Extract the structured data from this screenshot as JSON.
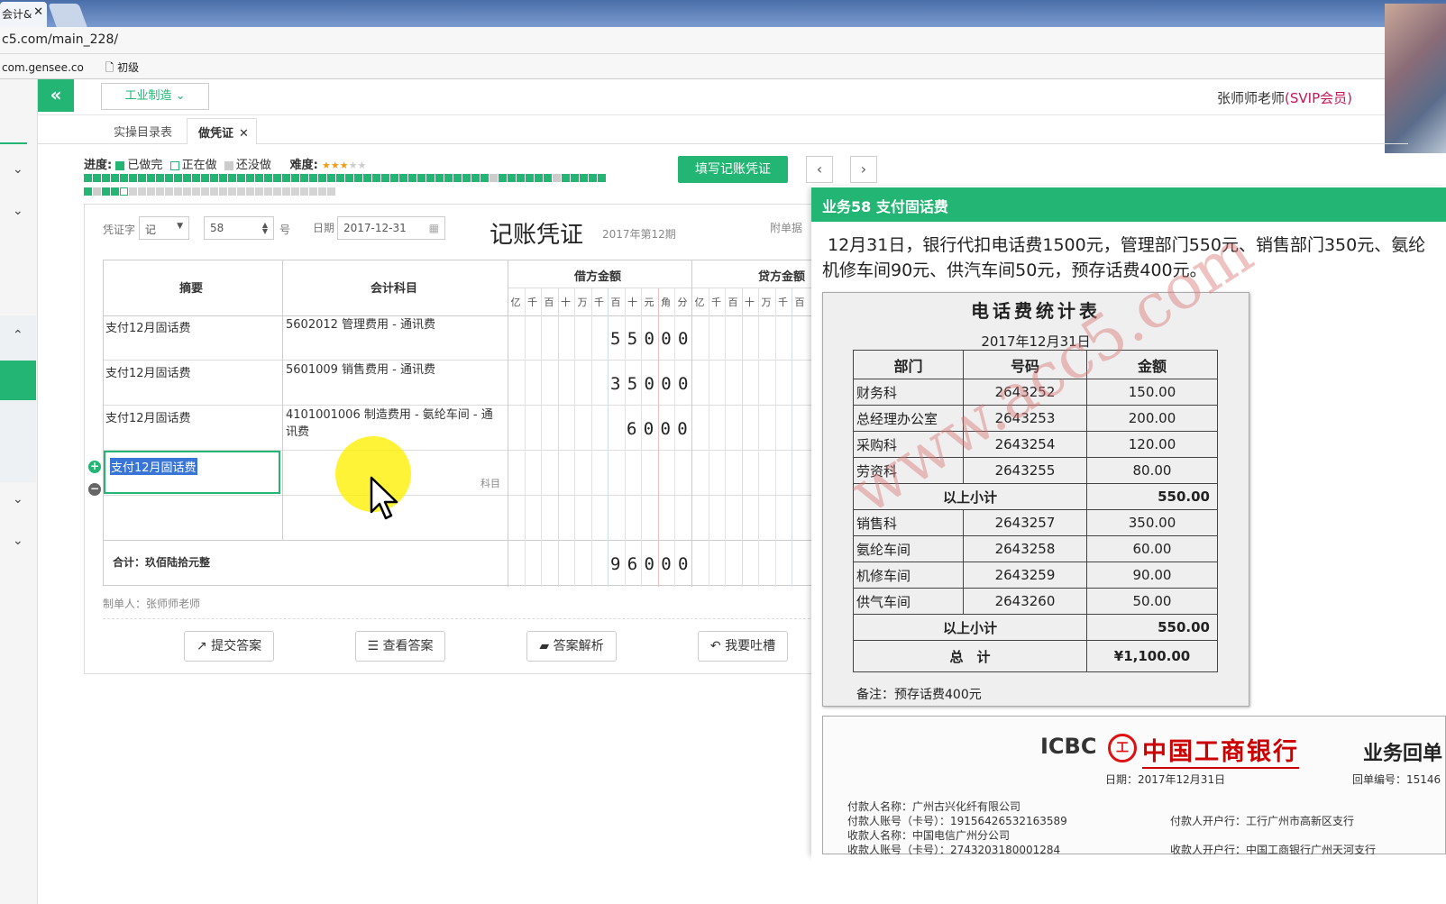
{
  "browser": {
    "tab_title": "会计&",
    "url": "c5.com/main_228/",
    "bookmark_1": "com.gensee.co",
    "bookmark_2": "初级"
  },
  "header": {
    "collapse_icon": "«",
    "industry_select": "工业制造",
    "teacher_name": "张师师老师",
    "member_badge": "(SVIP会员)"
  },
  "subtabs": {
    "tab1": "实操目录表",
    "tab2": "做凭证"
  },
  "progress": {
    "label": "进度:",
    "done": "已做完",
    "doing": "正在做",
    "todo": "还没做",
    "difficulty_label": "难度:",
    "difficulty_stars": 3,
    "difficulty_max": 5,
    "total_items": 86,
    "done_count": 62,
    "current_index": 62
  },
  "toolbar": {
    "fill_button": "填写记账凭证",
    "prev": "‹",
    "next": "›"
  },
  "voucher": {
    "word_label": "凭证字",
    "word_value": "记",
    "number_value": "58",
    "number_suffix": "号",
    "date_label": "日期",
    "date_value": "2017-12-31",
    "title": "记账凭证",
    "period": "2017年第12期",
    "attach_label": "附单据",
    "col_summary": "摘要",
    "col_subject": "会计科目",
    "col_debit": "借方金额",
    "col_credit": "贷方金额",
    "digit_units": [
      "亿",
      "千",
      "百",
      "十",
      "万",
      "千",
      "百",
      "十",
      "元",
      "角",
      "分"
    ],
    "credit_units_visible": [
      "亿",
      "千",
      "百",
      "十",
      "万",
      "千",
      "百"
    ],
    "rows": [
      {
        "summary": "支付12月固话费",
        "subject": "5602012 管理费用 - 通讯费",
        "debit": "55000"
      },
      {
        "summary": "支付12月固话费",
        "subject": "5601009 销售费用 - 通讯费",
        "debit": "35000"
      },
      {
        "summary": "支付12月固话费",
        "subject": "4101001006 制造费用 - 氨纶车间 - 通讯费",
        "debit": "6000"
      }
    ],
    "editing_summary": "支付12月固话费",
    "subject_hint": "科目",
    "total_label": "合计：玖佰陆拾元整",
    "total_debit": "96000",
    "maker": "制单人：张师师老师"
  },
  "actions": {
    "submit": "提交答案",
    "view": "查看答案",
    "analysis": "答案解析",
    "feedback": "我要吐槽"
  },
  "panel": {
    "title": "业务58 支付固话费",
    "desc_line1": "12月31日，银行代扣电话费1500元，管理部门550元、销售部门350元、氨纶",
    "desc_line2": "机修车间90元、供汽车间50元，预存话费400元。",
    "stat_title": "电话费统计表",
    "stat_date": "2017年12月31日",
    "stat_headers": [
      "部门",
      "号码",
      "金额"
    ],
    "stat_rows_a": [
      [
        "财务科",
        "2643252",
        "150.00"
      ],
      [
        "总经理办公室",
        "2643253",
        "200.00"
      ],
      [
        "采购科",
        "2643254",
        "120.00"
      ],
      [
        "劳资科",
        "2643255",
        "80.00"
      ]
    ],
    "subtotal_label": "以上小计",
    "subtotal_a": "550.00",
    "stat_rows_b": [
      [
        "销售科",
        "2643257",
        "350.00"
      ],
      [
        "氨纶车间",
        "2643258",
        "60.00"
      ],
      [
        "机修车间",
        "2643259",
        "90.00"
      ],
      [
        "供气车间",
        "2643260",
        "50.00"
      ]
    ],
    "subtotal_b": "550.00",
    "total_label": "总　计",
    "total_value": "¥1,100.00",
    "note": "备注：预存话费400元",
    "watermark": "www.acc5.com",
    "receipt": {
      "icbc": "ICBC",
      "logo_char": "工",
      "bank_name": "中国工商银行",
      "title": "业务回单",
      "date": "日期：2017年12月31日",
      "number": "回单编号：15146",
      "payer_name": "付款人名称：广州古兴化纤有限公司",
      "payer_account": "付款人账号（卡号）：19156426532163589",
      "payee_name": "收款人名称：中国电信广州分公司",
      "payee_account": "收款人账号（卡号）：2743203180001284",
      "payer_bank": "付款人开户行：工行广州市高新区支行",
      "payee_bank": "收款人开户行：中国工商银行广州天河支行"
    }
  },
  "colors": {
    "accent": "#22b573",
    "member": "#c2185b",
    "icbc_red": "#cc0000"
  }
}
